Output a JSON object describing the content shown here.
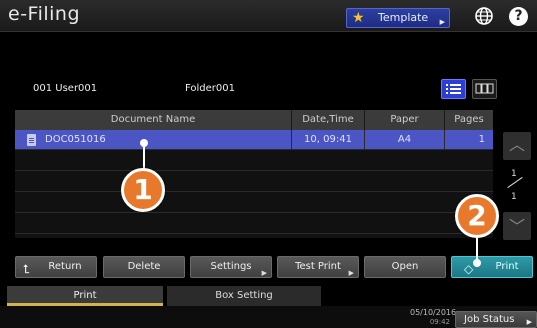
{
  "header": {
    "title": "e-Filing",
    "template_label": "Template",
    "icons": [
      "star-icon",
      "globe-icon",
      "help-icon"
    ],
    "help_glyph": "?"
  },
  "info": {
    "user": "001 User001",
    "folder": "Folder001"
  },
  "table": {
    "columns": [
      "Document Name",
      "Date,Time",
      "Paper",
      "Pages"
    ],
    "rows": [
      {
        "name": "DOC051016",
        "datetime": "10, 09:41",
        "paper": "A4",
        "pages": "1"
      }
    ]
  },
  "pager": {
    "current": "1",
    "total": "1"
  },
  "actions": {
    "return": "Return",
    "delete": "Delete",
    "settings": "Settings",
    "test_print": "Test Print",
    "open": "Open",
    "print": "Print"
  },
  "tabs": {
    "print": "Print",
    "box_setting": "Box Setting"
  },
  "footer": {
    "date": "05/10/2016",
    "time": "09:42",
    "job_status": "Job Status"
  },
  "callouts": {
    "one": "1",
    "two": "2"
  },
  "colors": {
    "accent": "#4b55c4",
    "print": "#1e7785",
    "callout": "#e8792c"
  }
}
